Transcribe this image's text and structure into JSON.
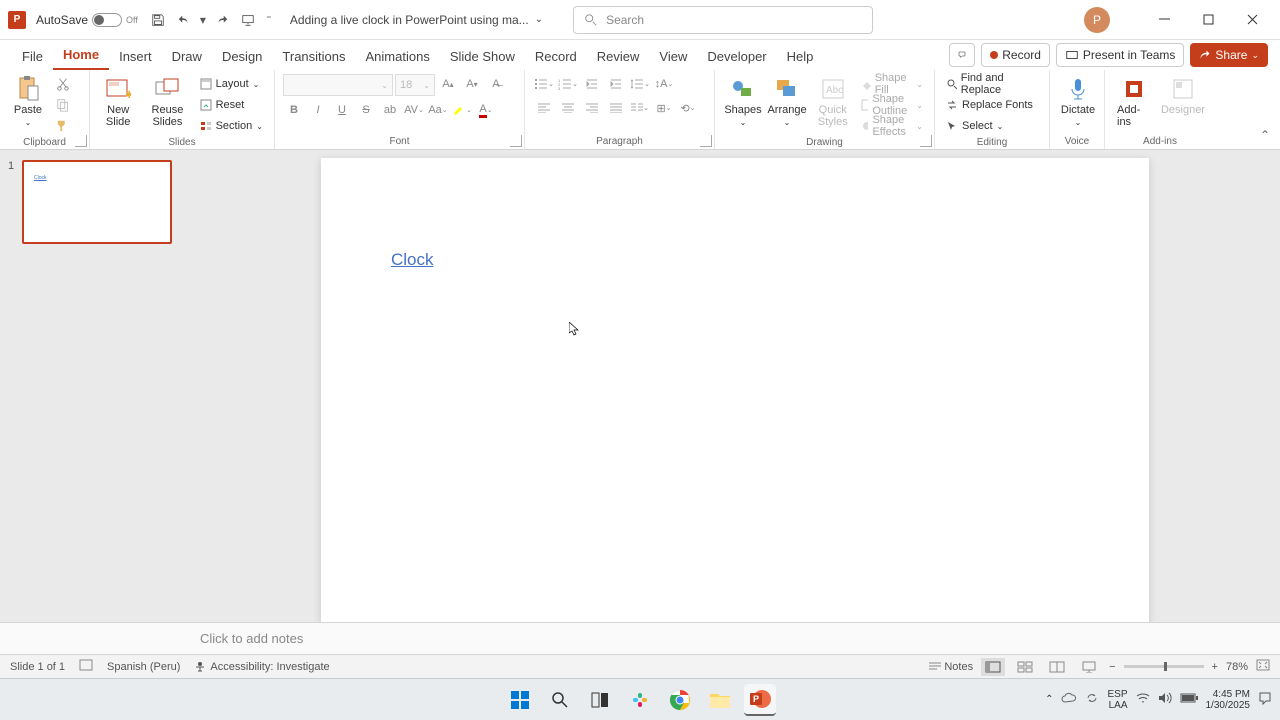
{
  "titlebar": {
    "autosave_label": "AutoSave",
    "autosave_state": "Off",
    "doc_title": "Adding a live clock in PowerPoint using ma...",
    "search_placeholder": "Search",
    "avatar_initial": "P"
  },
  "tabs": {
    "items": [
      "File",
      "Home",
      "Insert",
      "Draw",
      "Design",
      "Transitions",
      "Animations",
      "Slide Show",
      "Record",
      "Review",
      "View",
      "Developer",
      "Help"
    ],
    "active_index": 1,
    "record_label": "Record",
    "present_label": "Present in Teams",
    "share_label": "Share"
  },
  "ribbon": {
    "clipboard": {
      "label": "Clipboard",
      "paste": "Paste"
    },
    "slides": {
      "label": "Slides",
      "new_slide": "New Slide",
      "reuse": "Reuse Slides",
      "layout": "Layout",
      "reset": "Reset",
      "section": "Section"
    },
    "font": {
      "label": "Font",
      "size_value": "18"
    },
    "paragraph": {
      "label": "Paragraph"
    },
    "drawing": {
      "label": "Drawing",
      "shapes": "Shapes",
      "arrange": "Arrange",
      "quick": "Quick Styles",
      "fill": "Shape Fill",
      "outline": "Shape Outline",
      "effects": "Shape Effects"
    },
    "editing": {
      "label": "Editing",
      "find": "Find and Replace",
      "replace": "Replace Fonts",
      "select": "Select"
    },
    "voice": {
      "label": "Voice",
      "dictate": "Dictate"
    },
    "addins": {
      "label": "Add-ins",
      "addins_btn": "Add-ins",
      "designer_btn": "Designer"
    }
  },
  "slide": {
    "number": "1",
    "content_text": "Clock"
  },
  "notes": {
    "placeholder": "Click to add notes"
  },
  "statusbar": {
    "slide_info": "Slide 1 of 1",
    "language": "Spanish (Peru)",
    "accessibility": "Accessibility: Investigate",
    "notes_label": "Notes",
    "zoom": "78%"
  },
  "tray": {
    "lang1": "ESP",
    "lang2": "LAA",
    "time": "4:45 PM",
    "date": "1/30/2025"
  }
}
